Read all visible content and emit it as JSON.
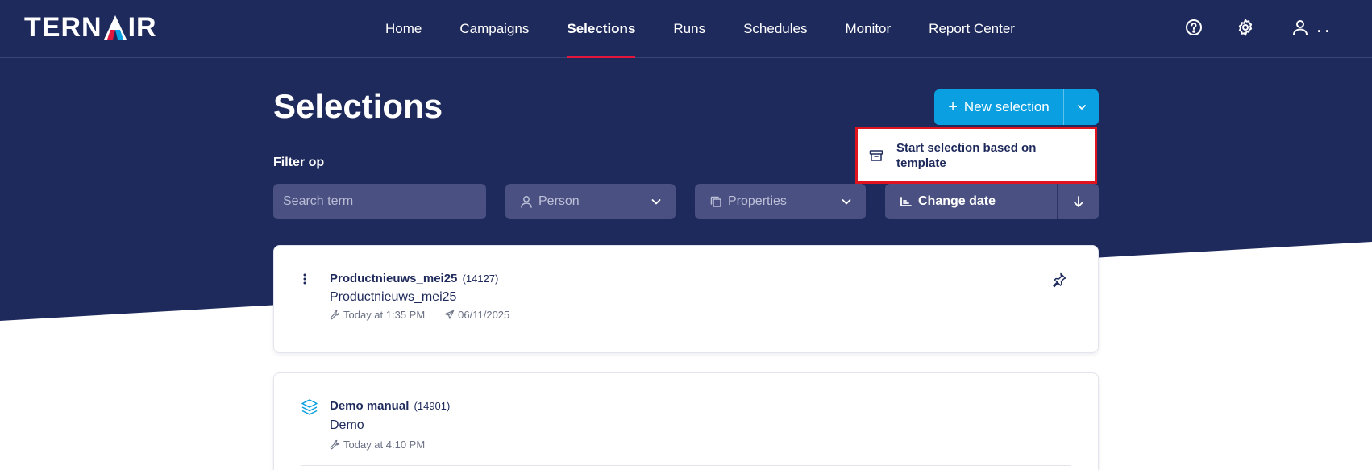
{
  "app": {
    "logo_text_left": "TERN",
    "logo_text_right": "IR"
  },
  "nav": {
    "items": [
      {
        "label": "Home",
        "active": false
      },
      {
        "label": "Campaigns",
        "active": false
      },
      {
        "label": "Selections",
        "active": true
      },
      {
        "label": "Runs",
        "active": false
      },
      {
        "label": "Schedules",
        "active": false
      },
      {
        "label": "Monitor",
        "active": false
      },
      {
        "label": "Report Center",
        "active": false
      }
    ],
    "icons": [
      "help-icon",
      "gear-icon",
      "user-icon"
    ],
    "user_label": ". ."
  },
  "page": {
    "title": "Selections"
  },
  "new_selection": {
    "label": "New selection",
    "plus": "+",
    "dropdown_item": "Start selection based on template"
  },
  "filters": {
    "label": "Filter op",
    "search_placeholder": "Search term",
    "person_label": "Person",
    "properties_label": "Properties",
    "sort_label": "Change date"
  },
  "selections": [
    {
      "name": "Productnieuws_mei25",
      "id": "(14127)",
      "subtitle": "Productnieuws_mei25",
      "modified": "Today at 1:35 PM",
      "sent": "06/11/2025",
      "icon": "more-vertical-icon"
    },
    {
      "name": "Demo manual",
      "id": "(14901)",
      "subtitle": "Demo",
      "modified": "Today at 4:10 PM",
      "icon": "layers-icon"
    }
  ],
  "colors": {
    "navy": "#1f2a5c",
    "accent_blue": "#0a9fe0",
    "active_red": "#e3173e",
    "highlight_red": "#e0141e"
  }
}
